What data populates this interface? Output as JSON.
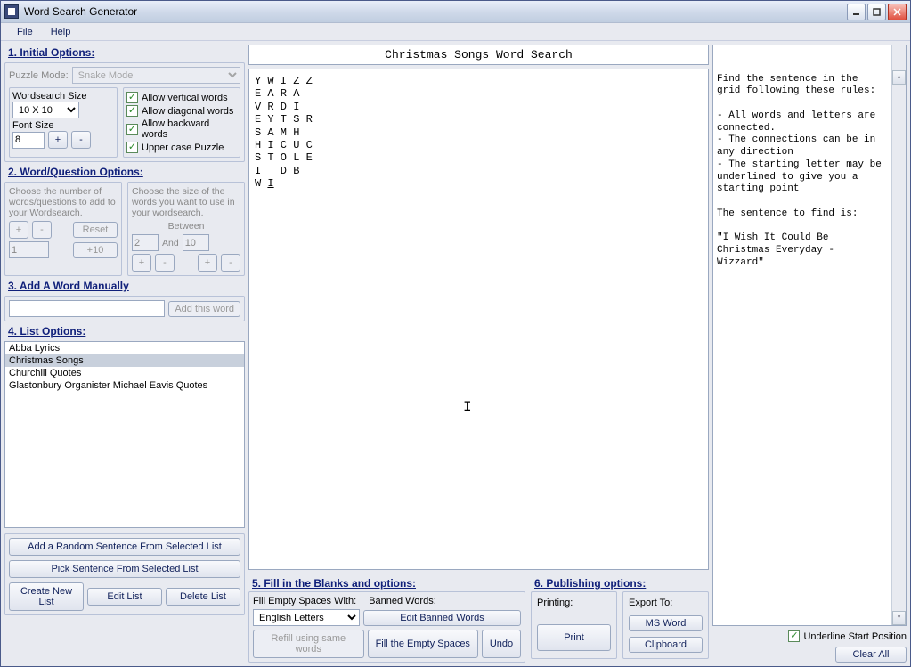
{
  "titlebar": {
    "title": "Word Search Generator"
  },
  "menu": {
    "file": "File",
    "help": "Help"
  },
  "sections": {
    "initial": "1. Initial Options:",
    "wq": "2. Word/Question Options:",
    "addword": "3. Add A Word Manually",
    "list": "4. List Options:",
    "fill": "5. Fill in the Blanks and options:",
    "publish": "6. Publishing options:"
  },
  "initial": {
    "puzzle_mode_label": "Puzzle Mode:",
    "puzzle_mode_value": "Snake Mode",
    "ws_size_label": "Wordsearch Size",
    "ws_size_value": "10 X 10",
    "font_size_label": "Font Size",
    "font_size_value": "8",
    "plus": "+",
    "minus": "-",
    "allow_vertical": "Allow vertical words",
    "allow_diagonal": "Allow diagonal words",
    "allow_backward": "Allow backward words",
    "upper_case": "Upper case Puzzle"
  },
  "wq": {
    "left_text": "Choose the number of words/questions to add to your Wordsearch.",
    "right_text": "Choose the size of the words you want to use in your wordsearch.",
    "between": "Between",
    "and": "And",
    "min": "2",
    "max": "10",
    "count": "1",
    "plus": "+",
    "minus": "-",
    "reset": "Reset",
    "plus10": "+10"
  },
  "addword": {
    "value": "",
    "btn": "Add this word"
  },
  "list": {
    "items": [
      "Abba Lyrics",
      "Christmas Songs",
      "Churchill Quotes",
      "Glastonbury Organister Michael Eavis Quotes"
    ],
    "selected_index": 1,
    "add_random": "Add a Random Sentence From Selected List",
    "pick": "Pick Sentence From Selected List",
    "create": "Create New List",
    "edit": "Edit List",
    "delete": "Delete List"
  },
  "puzzle": {
    "title": "Christmas Songs Word Search",
    "lines": [
      "Y W I Z Z",
      "E A R A",
      "V R D I",
      "E Y T S R",
      "S A M H",
      "H I C U C",
      "S T O L E",
      "I   D B",
      "W I"
    ]
  },
  "rules": {
    "text": "Find the sentence in the grid following these rules:\n\n- All words and letters are connected.\n- The connections can be in any direction\n- The starting letter may be underlined to give you a starting point\n\nThe sentence to find is:\n\n\"I Wish It Could Be Christmas Everyday - Wizzard\"",
    "underline_label": "Underline Start Position",
    "clear_all": "Clear All"
  },
  "fill": {
    "empty_label": "Fill Empty Spaces With:",
    "empty_value": "English Letters",
    "banned_label": "Banned Words:",
    "edit_banned": "Edit Banned Words",
    "refill": "Refill using same words",
    "fill_empty": "Fill the Empty Spaces",
    "undo": "Undo"
  },
  "publish": {
    "printing_label": "Printing:",
    "print": "Print",
    "export_label": "Export To:",
    "msword": "MS Word",
    "clipboard": "Clipboard"
  }
}
